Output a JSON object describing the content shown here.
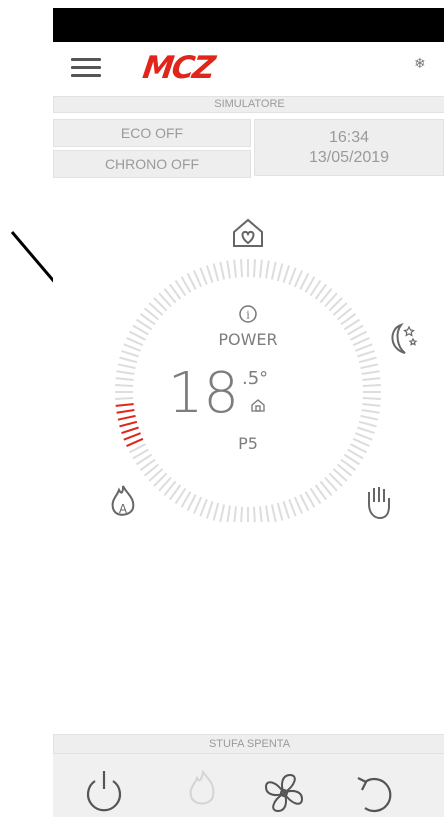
{
  "header": {
    "brand": "MCZ",
    "menu_icon": "hamburger-icon",
    "status_icon": "snowflake-icon"
  },
  "simulator_label": "SIMULATORE",
  "eco": "ECO OFF",
  "chrono": "CHRONO OFF",
  "time": "16:34",
  "date": "13/05/2019",
  "dial": {
    "mode_label": "POWER",
    "temperature_int": "18",
    "temperature_dec": ".5°",
    "power_level": "P5",
    "active_segments_fraction": 0.06,
    "icons": [
      "home-heart-icon",
      "moon-stars-icon",
      "hand-icon",
      "flame-a-icon",
      "power-signal-icon",
      "info-icon",
      "home-small-icon"
    ]
  },
  "stove_status": "STUFA SPENTA",
  "footer_icons": [
    "power-icon",
    "flame-icon",
    "fan-icon",
    "reset-icon"
  ],
  "colors": {
    "accent": "#e1251b",
    "bar": "#eeeeee",
    "text": "#8a8a8a"
  }
}
